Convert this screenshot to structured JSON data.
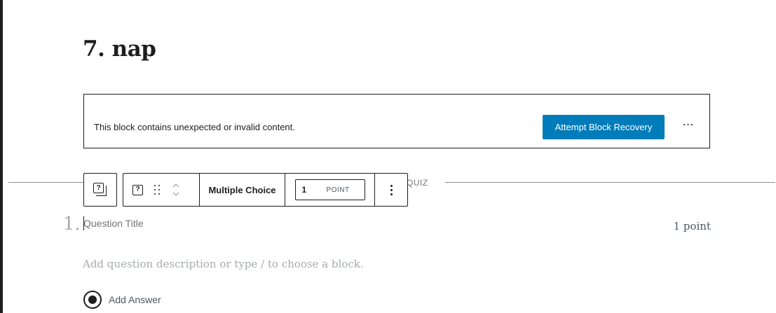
{
  "page": {
    "title": "7. nap"
  },
  "invalid_block": {
    "message": "This block contains unexpected or invalid content.",
    "recovery_label": "Attempt Block Recovery",
    "more_label": "⋯"
  },
  "quiz": {
    "separator_label": "QUIZ"
  },
  "toolbar": {
    "parent_icon_glyph": "?",
    "block_icon_glyph": "?",
    "type_label": "Multiple Choice",
    "points_value": "1",
    "points_unit": "POINT"
  },
  "question": {
    "number": "1.",
    "title_placeholder": "Question Title",
    "points_label": "1 point",
    "description_placeholder": "Add question description or type / to choose a block.",
    "add_answer_label": "Add Answer"
  },
  "colors": {
    "primary_button": "#007cba",
    "border": "#1e1e1e",
    "muted_text": "#a7aaad"
  }
}
